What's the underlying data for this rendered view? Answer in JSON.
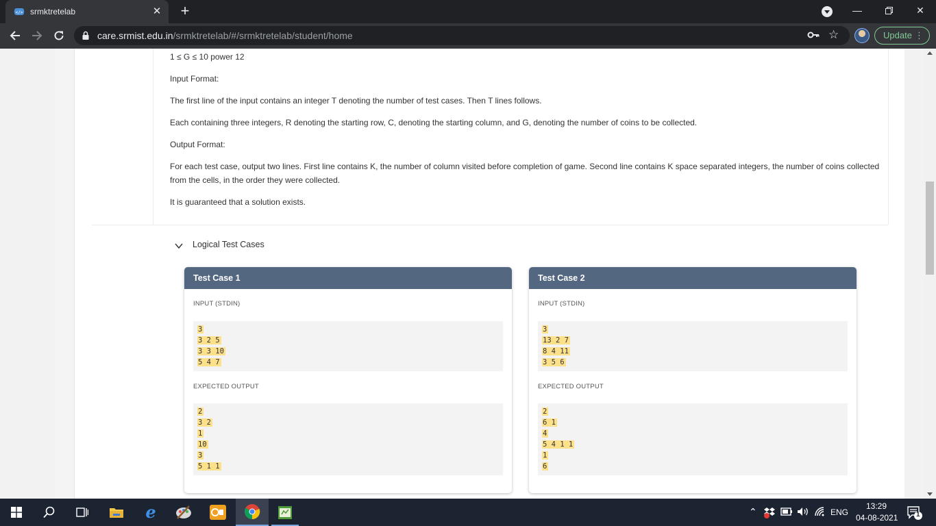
{
  "browser": {
    "tab_title": "srmktretelab",
    "url_host": "care.srmist.edu.in",
    "url_path": "/srmktretelab/#/srmktretelab/student/home",
    "update_label": "Update"
  },
  "problem": {
    "constraint": "1 ≤ G ≤ 10 power 12",
    "input_format_title": "Input Format:",
    "input_line1": "The first line of the input contains an integer T denoting the number of test cases. Then T lines follows.",
    "input_line2": "Each containing three integers, R denoting the starting row, C, denoting the starting column, and G, denoting the number of coins to be collected.",
    "output_format_title": "Output Format:",
    "output_line1": "For each test case, output two lines. First line contains K, the number of column visited before completion of game. Second line contains K space separated integers, the number of coins collected from the cells, in the order they were collected.",
    "guarantee": "It is guaranteed that a solution exists."
  },
  "test_cases_section": {
    "title": "Logical Test Cases",
    "input_label": "INPUT (STDIN)",
    "output_label": "EXPECTED OUTPUT",
    "cases": [
      {
        "title": "Test Case 1",
        "input": [
          "3",
          "3 2 5",
          "3 3 10",
          "5 4 7"
        ],
        "output": [
          "2",
          "3 2",
          "1",
          "10",
          "3",
          "5 1 1"
        ]
      },
      {
        "title": "Test Case 2",
        "input": [
          "3",
          "13 2 7",
          "8 4 11",
          "3 5 6"
        ],
        "output": [
          "2",
          "6 1",
          "4",
          "5 4 1 1",
          "1",
          "6"
        ]
      }
    ]
  },
  "taskbar": {
    "language": "ENG",
    "time": "13:29",
    "date": "04-08-2021",
    "notification_count": "1"
  }
}
